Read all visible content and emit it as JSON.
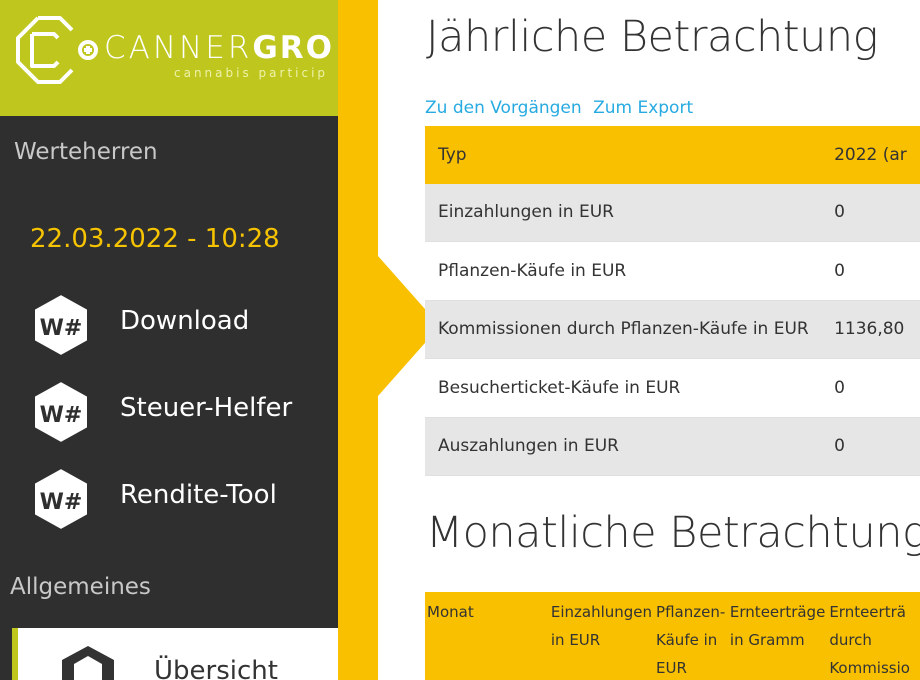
{
  "sidebar": {
    "logo": {
      "word_light": "CANNER",
      "word_bold": "GRO",
      "tagline": "cannabis particip"
    },
    "section_1": "Werteherren",
    "timestamp": "22.03.2022 - 10:28",
    "items": [
      {
        "label": "Download",
        "icon": "wh-icon"
      },
      {
        "label": "Steuer-Helfer",
        "icon": "wh-icon"
      },
      {
        "label": "Rendite-Tool",
        "icon": "wh-icon"
      }
    ],
    "section_2": "Allgemeines",
    "active_item": {
      "label": "Übersicht",
      "icon": "overview-icon"
    }
  },
  "colors": {
    "brand_green": "#bfc61e",
    "accent_yellow": "#f9c000",
    "sidebar_bg": "#2f2f2f",
    "link_blue": "#27aae1"
  },
  "yearly": {
    "title": "Jährliche Betrachtung",
    "links": [
      "Zu den Vorgängen",
      "Zum Export"
    ],
    "header": {
      "type": "Typ",
      "year": "2022 (ar"
    },
    "rows": [
      {
        "label": "Einzahlungen in EUR",
        "value": "0"
      },
      {
        "label": "Pflanzen-Käufe in EUR",
        "value": "0"
      },
      {
        "label": "Kommissionen durch Pflanzen-Käufe in EUR",
        "value": "1136,80"
      },
      {
        "label": "Besucherticket-Käufe in EUR",
        "value": "0"
      },
      {
        "label": "Auszahlungen in EUR",
        "value": "0"
      }
    ]
  },
  "monthly": {
    "title": "Monatliche Betrachtung",
    "columns": [
      "Monat",
      "Einzahlungen in EUR",
      "Pflanzen-Käufe in EUR",
      "Ernteerträge in Gramm",
      "Ernteerträ durch Kommissio"
    ]
  }
}
